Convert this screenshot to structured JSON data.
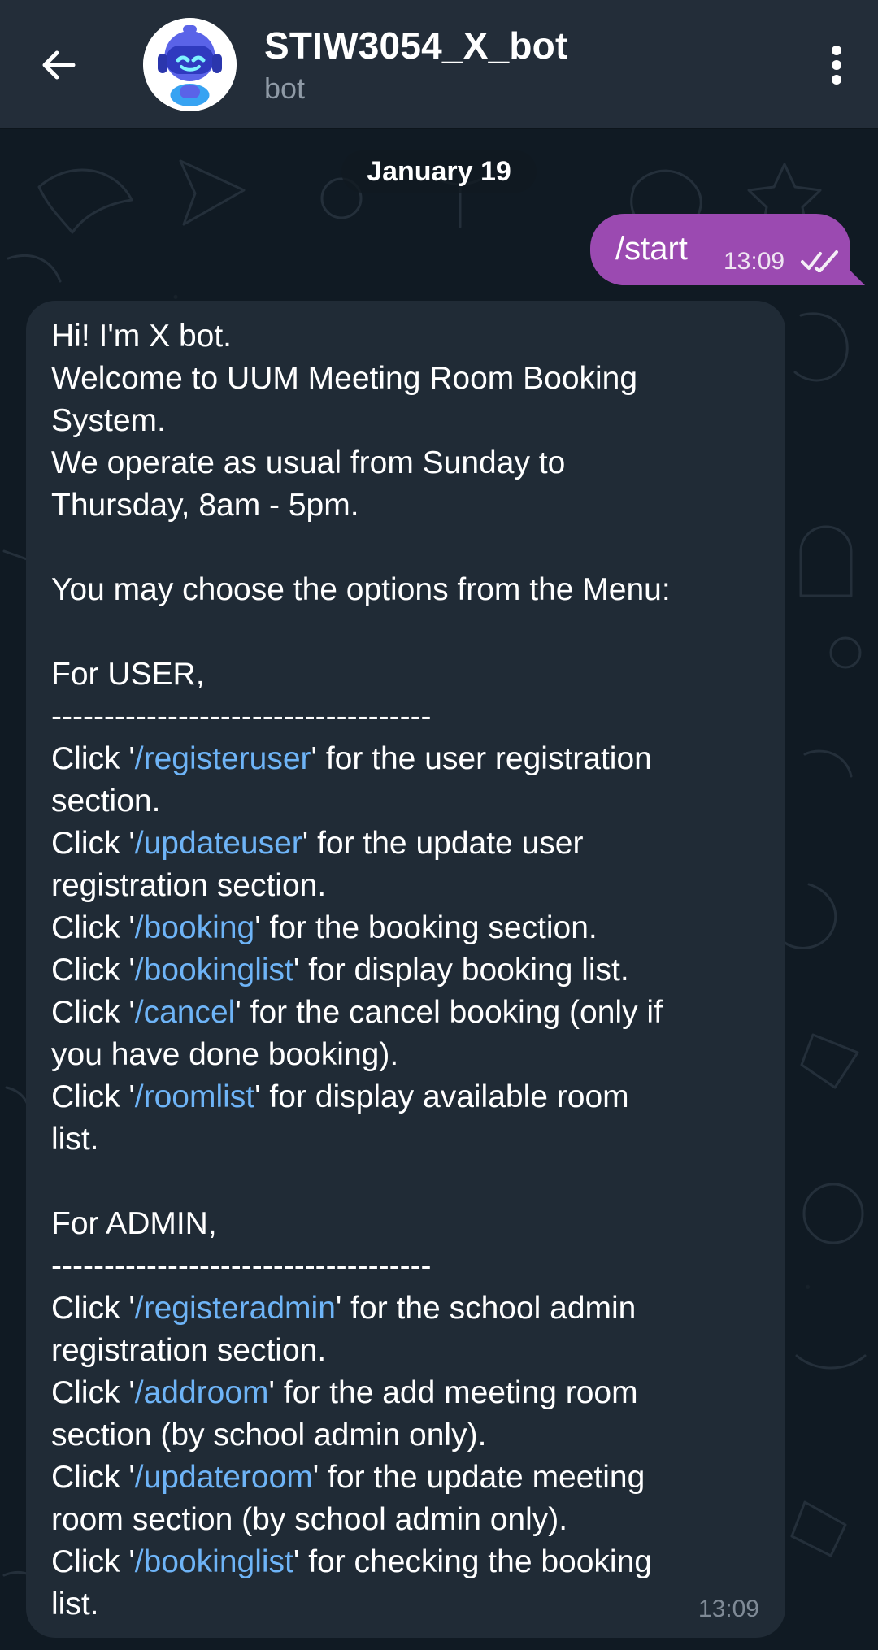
{
  "header": {
    "title": "STIW3054_X_bot",
    "subtitle": "bot",
    "back_icon": "arrow-left-icon",
    "menu_icon": "more-vertical-icon",
    "avatar_icon": "robot-avatar-icon"
  },
  "chat": {
    "date": "January 19",
    "outgoing": {
      "text": "/start",
      "time": "13:09",
      "status_icon": "double-check-icon"
    },
    "incoming": {
      "time": "13:09",
      "lines": [
        [
          "Hi! I'm X bot."
        ],
        [
          "Welcome to UUM Meeting Room Booking"
        ],
        [
          "System."
        ],
        [
          "We operate as usual from Sunday to"
        ],
        [
          "Thursday, 8am - 5pm."
        ],
        [
          ""
        ],
        [
          "You may choose the options from the Menu:"
        ],
        [
          ""
        ],
        [
          "For USER,"
        ],
        [
          "------------------------------------"
        ],
        [
          "Click '",
          "/registeruser",
          "' for the user registration"
        ],
        [
          "section."
        ],
        [
          "Click '",
          "/updateuser",
          "' for the update user"
        ],
        [
          "registration section."
        ],
        [
          "Click '",
          "/booking",
          "' for the booking section."
        ],
        [
          "Click '",
          "/bookinglist",
          "' for display booking list."
        ],
        [
          "Click '",
          "/cancel",
          "' for the cancel booking (only if"
        ],
        [
          "you have done booking)."
        ],
        [
          "Click '",
          "/roomlist",
          "' for display available room"
        ],
        [
          "list."
        ],
        [
          ""
        ],
        [
          "For ADMIN,"
        ],
        [
          "------------------------------------"
        ],
        [
          "Click '",
          "/registeradmin",
          "' for the school admin"
        ],
        [
          "registration section."
        ],
        [
          "Click '",
          "/addroom",
          "' for the add meeting room"
        ],
        [
          "section (by school admin only)."
        ],
        [
          "Click '",
          "/updateroom",
          "' for the update meeting"
        ],
        [
          "room section (by school admin only)."
        ],
        [
          "Click '",
          "/bookinglist",
          "' for checking the booking"
        ],
        [
          "list."
        ]
      ]
    }
  },
  "colors": {
    "header": "#232d39",
    "background": "#101a23",
    "outgoing_bubble": "#9b4ab1",
    "incoming_bubble": "#202b36",
    "link": "#6eb4f7",
    "muted_text": "#8f9aa6"
  }
}
